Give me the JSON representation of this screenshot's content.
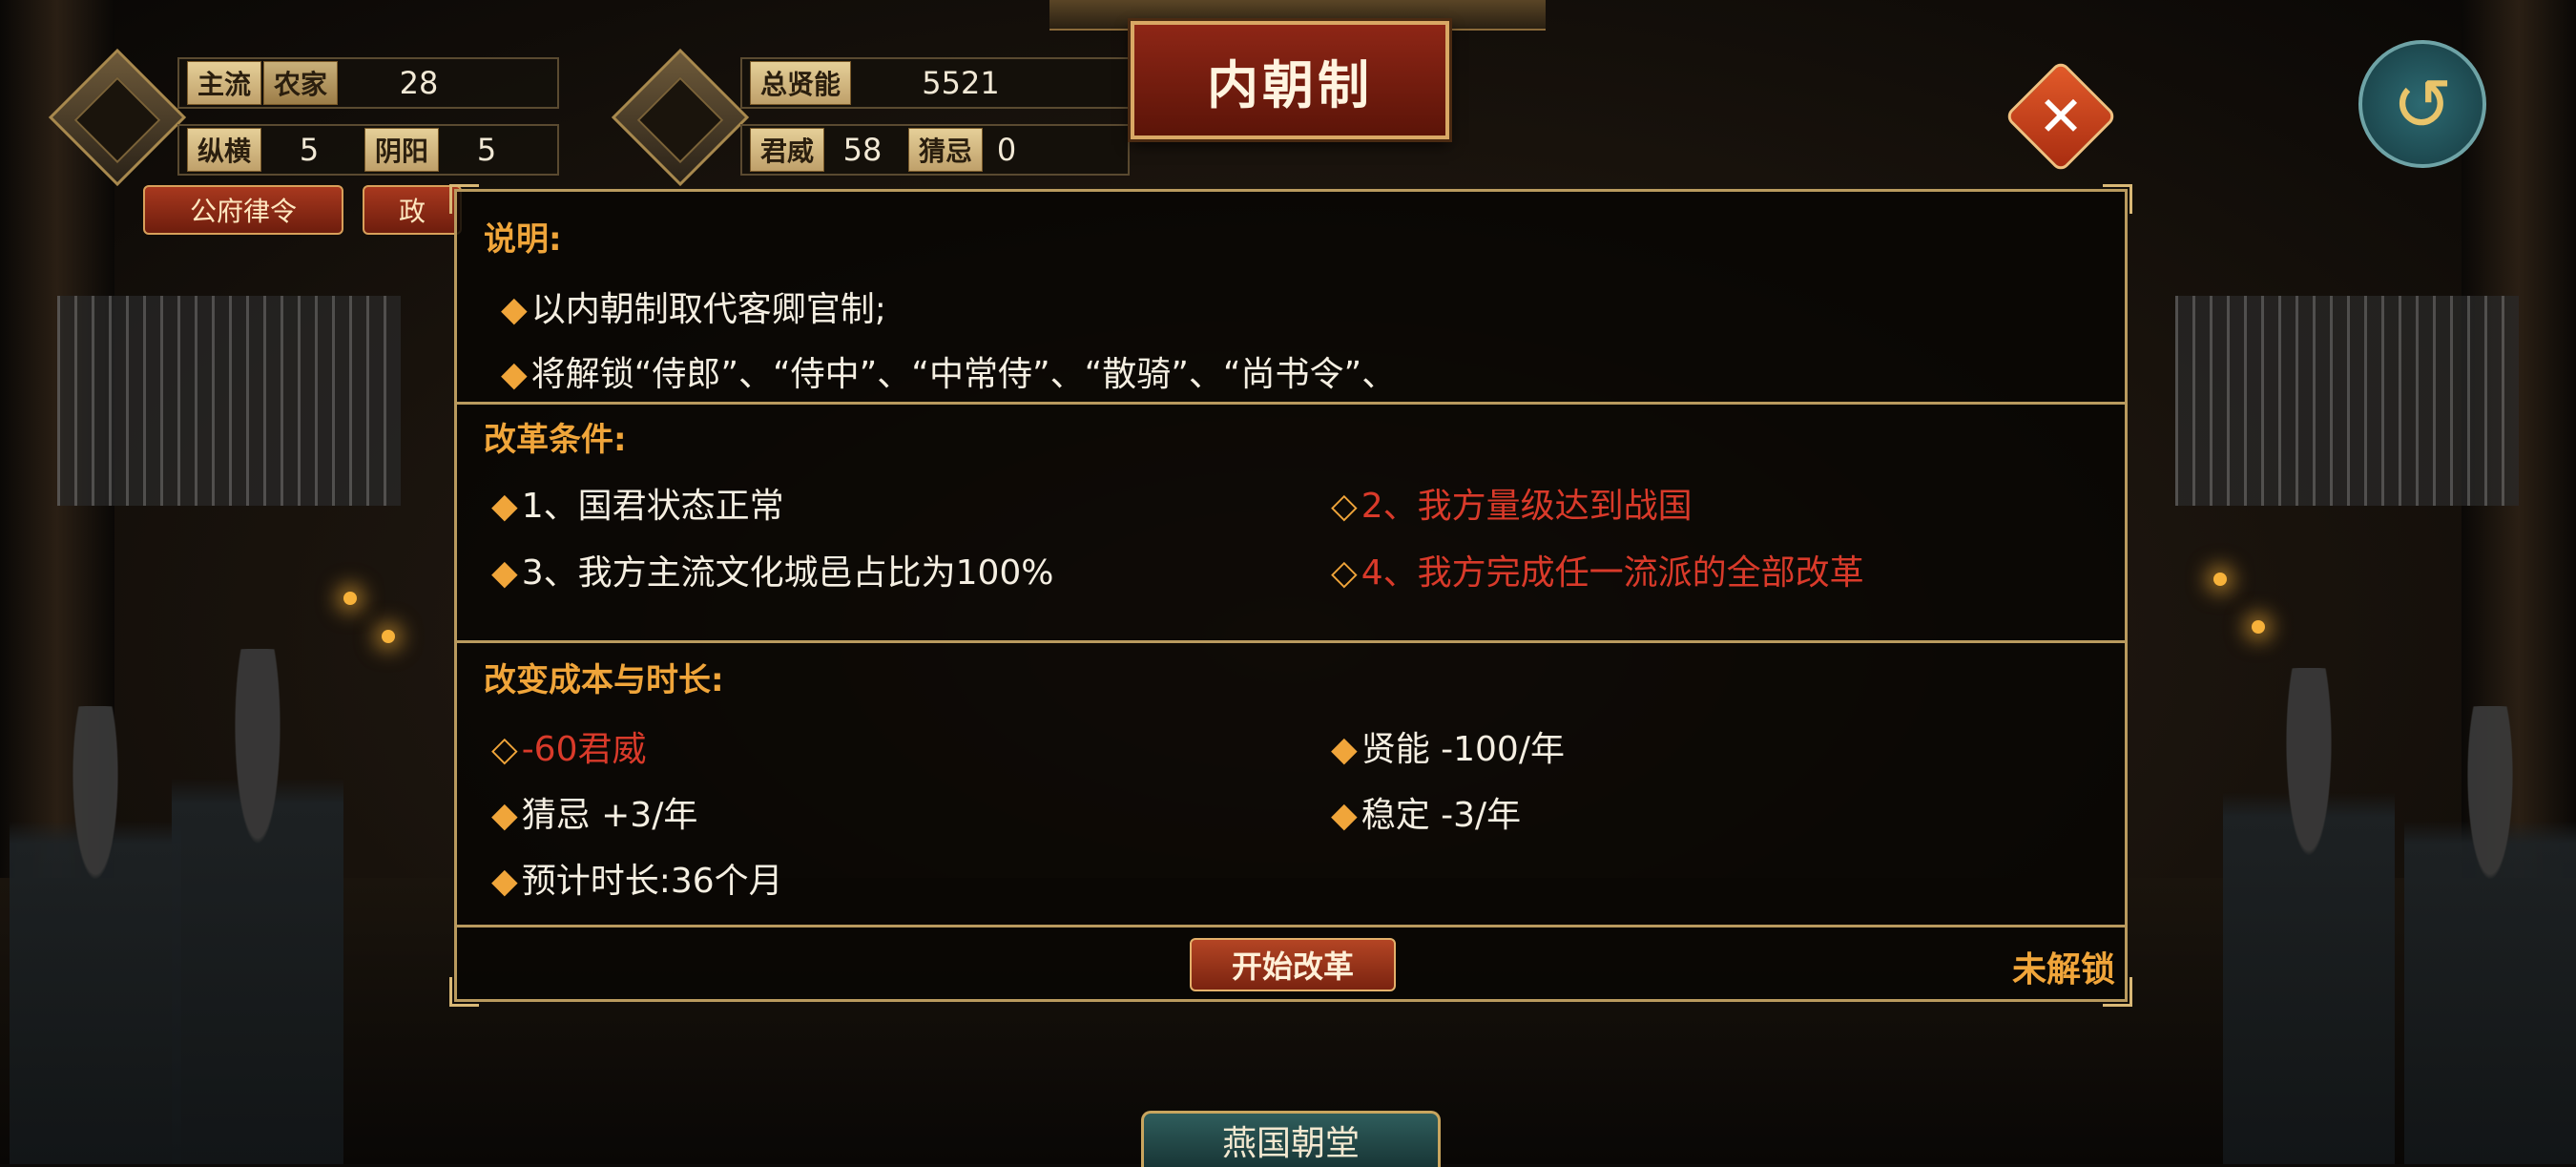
{
  "hud": {
    "mainstream_label": "主流",
    "mainstream_value": "农家",
    "mainstream_count": "28",
    "zongheng_label": "纵横",
    "zongheng_value": "5",
    "yinyang_label": "阴阳",
    "yinyang_value": "5",
    "total_talent_label": "总贤能",
    "total_talent_value": "5521",
    "prestige_label": "君威",
    "prestige_value": "58",
    "suspicion_label": "猜忌",
    "suspicion_value": "0",
    "btn_law": "公府律令",
    "btn_policy": "政"
  },
  "title": "内朝制",
  "panel": {
    "desc_head": "说明:",
    "desc_lines": [
      "以内朝制取代客卿官制;",
      "将解锁“侍郎”、“侍中”、“中常侍”、“散骑”、“尚书令”、"
    ],
    "cond_head": "改革条件:",
    "conditions": [
      {
        "text": "1、国君状态正常",
        "met": true
      },
      {
        "text": "2、我方量级达到战国",
        "met": false
      },
      {
        "text": "3、我方主流文化城邑占比为100%",
        "met": true
      },
      {
        "text": "4、我方完成任一流派的全部改革",
        "met": false
      }
    ],
    "cost_head": "改变成本与时长:",
    "costs": [
      {
        "text": "-60君威",
        "met": false
      },
      {
        "text": "贤能 -100/年",
        "met": true
      },
      {
        "text": "猜忌 +3/年",
        "met": true
      },
      {
        "text": "稳定 -3/年",
        "met": true
      },
      {
        "text": "预计时长:36个月",
        "met": true
      }
    ],
    "start_button": "开始改革",
    "status": "未解锁"
  },
  "close_icon": "close-icon",
  "back_icon": "back-arrow-icon",
  "bottom_tab": "燕国朝堂",
  "colors": {
    "accent": "#f0a53a",
    "unmet_red": "#d93a2a",
    "title_red": "#8e2616",
    "gold_border": "#b99a5e"
  }
}
